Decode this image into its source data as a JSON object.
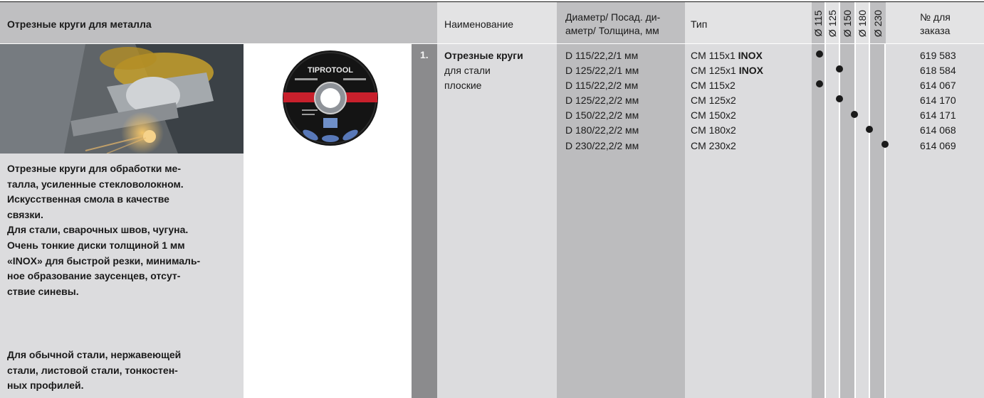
{
  "section_title": "Отрезные круги для металла",
  "headers": {
    "name": "Наименование",
    "dimensions": [
      "Диаметр/ Посад. ди-",
      "аметр/ Толщина, мм"
    ],
    "type": "Тип",
    "diameters": [
      "Ø 115",
      "Ø 125",
      "Ø 150",
      "Ø 180",
      "Ø 230"
    ],
    "order": [
      "№ для",
      "заказа"
    ]
  },
  "item_number": "1.",
  "product_name": {
    "title": "Отрезные круги",
    "line2": "для стали",
    "line3": "плоские"
  },
  "disc_label": {
    "brand": "TIPROTOOL",
    "colors": {
      "disc": "#111111",
      "stripe": "#c8202c"
    }
  },
  "rows": [
    {
      "dim": "D 115/22,2/1 мм",
      "type": "CM 115x1",
      "type_bold": "INOX",
      "order": "619 583",
      "diameter": "Ø 115"
    },
    {
      "dim": "D 125/22,2/1 мм",
      "type": "CM 125x1",
      "type_bold": "INOX",
      "order": "618 584",
      "diameter": "Ø 125"
    },
    {
      "dim": "D 115/22,2/2 мм",
      "type": "CM 115x2",
      "type_bold": "",
      "order": "614 067",
      "diameter": "Ø 115"
    },
    {
      "dim": "D 125/22,2/2 мм",
      "type": "CM 125x2",
      "type_bold": "",
      "order": "614 170",
      "diameter": "Ø 125"
    },
    {
      "dim": "D 150/22,2/2 мм",
      "type": "CM 150x2",
      "type_bold": "",
      "order": "614 171",
      "diameter": "Ø 150"
    },
    {
      "dim": "D 180/22,2/2 мм",
      "type": "CM 180x2",
      "type_bold": "",
      "order": "614 068",
      "diameter": "Ø 180"
    },
    {
      "dim": "D 230/22,2/2 мм",
      "type": "CM 230x2",
      "type_bold": "",
      "order": "614 069",
      "diameter": "Ø 230"
    }
  ],
  "description": {
    "para1": [
      "Отрезные круги для обработки ме-",
      "талла, усиленные стекловолокном.",
      "Искусственная смола в качестве",
      "связки.",
      "Для стали, сварочных швов, чугуна.",
      "Очень тонкие диски толщиной 1 мм",
      "«INOX» для быстрой резки, минималь-",
      "ное образование заусенцев, отсут-",
      "ствие синевы."
    ],
    "para2": [
      "Для обычной стали, нержавеющей",
      "стали, листовой стали, тонкостен-",
      "ных профилей."
    ]
  }
}
